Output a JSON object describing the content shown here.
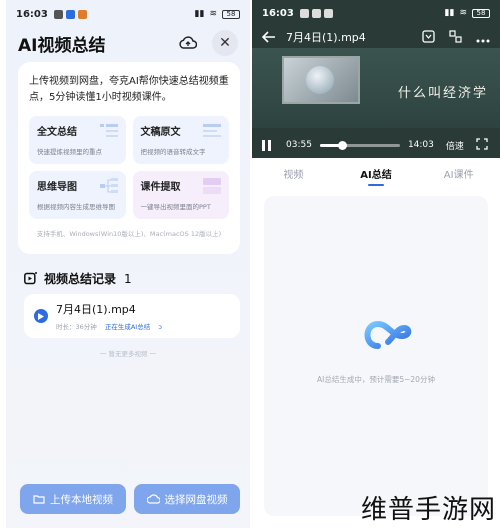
{
  "left": {
    "status": {
      "time": "16:03",
      "battery": "58"
    },
    "title": "AI视频总结",
    "intro": "上传视频到网盘，夸克AI帮你快速总结视频重点，5分钟读懂1小时视频课件。",
    "features": [
      {
        "name": "全文总结",
        "desc": "快速提炼视频里的重点"
      },
      {
        "name": "文稿原文",
        "desc": "把视频的语音转成文字"
      },
      {
        "name": "思维导图",
        "desc": "根据视频内容生成思维导图"
      },
      {
        "name": "课件提取",
        "desc": "一键导出视频里面的PPT"
      }
    ],
    "support": "支持手机、Windows(Win10版以上)、Mac(macOS 12版以上)",
    "records": {
      "title": "视频总结记录",
      "count": "1",
      "items": [
        {
          "name": "7月4日(1).mp4",
          "meta": "时长：36分钟",
          "status": "正在生成AI总结"
        }
      ]
    },
    "more": "一 暂无更多视频 一",
    "buttons": {
      "upload": "上传本地视频",
      "select": "选择网盘视频"
    }
  },
  "right": {
    "status": {
      "time": "16:03",
      "battery": "58"
    },
    "video_title": "7月4日(1).mp4",
    "board_text": "什么叫经济学",
    "current_time": "03:55",
    "duration": "14:03",
    "speed": "倍速",
    "progress": 0.28,
    "tabs": [
      {
        "label": "视频"
      },
      {
        "label": "AI总结"
      },
      {
        "label": "AI课件"
      }
    ],
    "ai_status": "AI总结生成中，预计需要5~20分钟"
  },
  "watermark": "维普手游网",
  "colors": {
    "accent": "#2d6be0",
    "button": "#7fa5ec"
  }
}
